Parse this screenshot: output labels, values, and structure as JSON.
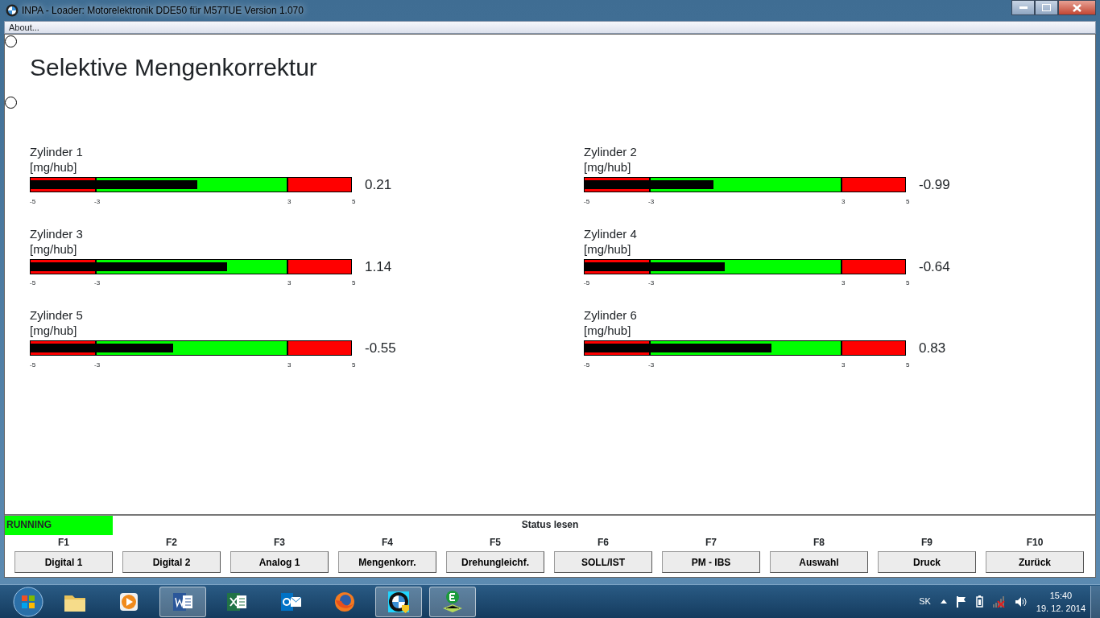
{
  "window": {
    "title": "INPA - Loader:  Motorelektronik DDE50 für M57TUE Version 1.070"
  },
  "menu": [
    {
      "label": "About..."
    }
  ],
  "radios": [
    {
      "selected": false
    },
    {
      "selected": false
    }
  ],
  "page": {
    "title": "Selektive Mengenkorrektur"
  },
  "gauges": [
    {
      "name": "Zylinder 1",
      "unit": "[mg/hub]",
      "level": 0.521,
      "reading": "0.21",
      "ticks": [
        "-5",
        "-3",
        "3",
        "5"
      ]
    },
    {
      "name": "Zylinder 2",
      "unit": "[mg/hub]",
      "level": 0.401,
      "reading": "-0.99",
      "ticks": [
        "-5",
        "-3",
        "3",
        "5"
      ]
    },
    {
      "name": "Zylinder 3",
      "unit": "[mg/hub]",
      "level": 0.614,
      "reading": "1.14",
      "ticks": [
        "-5",
        "-3",
        "3",
        "5"
      ]
    },
    {
      "name": "Zylinder 4",
      "unit": "[mg/hub]",
      "level": 0.436,
      "reading": "-0.64",
      "ticks": [
        "-5",
        "-3",
        "3",
        "5"
      ]
    },
    {
      "name": "Zylinder 5",
      "unit": "[mg/hub]",
      "level": 0.445,
      "reading": "-0.55",
      "ticks": [
        "-5",
        "-3",
        "3",
        "5"
      ]
    },
    {
      "name": "Zylinder 6",
      "unit": "[mg/hub]",
      "level": 0.583,
      "reading": "0.83",
      "ticks": [
        "-5",
        "-3",
        "3",
        "5"
      ]
    }
  ],
  "status": {
    "text": "RUNNING",
    "color": "#00ff00",
    "title": "Status lesen"
  },
  "function_keys": [
    {
      "key": "F1",
      "label": "Digital 1"
    },
    {
      "key": "F2",
      "label": "Digital 2"
    },
    {
      "key": "F3",
      "label": "Analog 1"
    },
    {
      "key": "F4",
      "label": "Mengenkorr."
    },
    {
      "key": "F5",
      "label": "Drehungleichf."
    },
    {
      "key": "F6",
      "label": "SOLL/IST"
    },
    {
      "key": "F7",
      "label": "PM - IBS"
    },
    {
      "key": "F8",
      "label": "Auswahl"
    },
    {
      "key": "F9",
      "label": "Druck"
    },
    {
      "key": "F10",
      "label": "Zurück"
    }
  ],
  "taskbar": {
    "apps": [
      {
        "kind": "folder",
        "selected": false
      },
      {
        "kind": "media",
        "selected": false
      },
      {
        "kind": "word",
        "selected": true
      },
      {
        "kind": "excel",
        "selected": false
      },
      {
        "kind": "outlook",
        "selected": false
      },
      {
        "kind": "firefox",
        "selected": false
      },
      {
        "kind": "roundel",
        "selected": true
      },
      {
        "kind": "editor",
        "selected": true
      }
    ],
    "language": "SK",
    "time": "15:40",
    "date": "19. 12. 2014"
  }
}
